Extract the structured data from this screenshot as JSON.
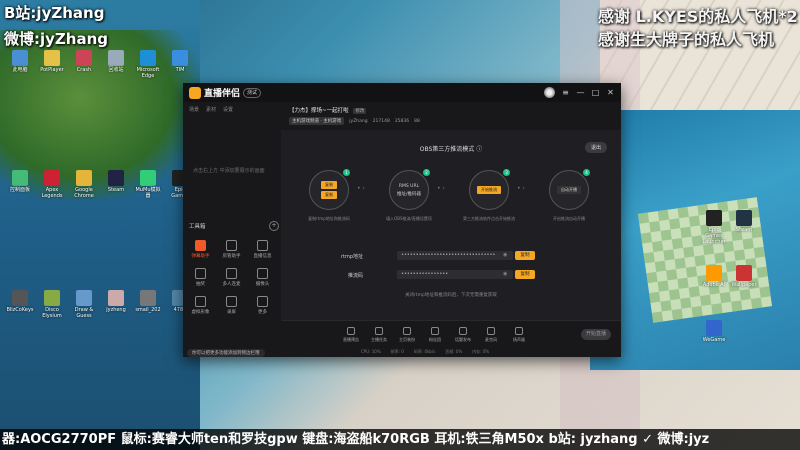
{
  "stream_overlay": {
    "top_left_1": "B站:jyZhang",
    "top_left_2": "微博:jyZhang",
    "top_right_1": "感谢 L.KYES的私人飞机*2",
    "top_right_2": "感谢生大牌子的私人飞机",
    "bottom_bar": "器:AOCG2770PF  鼠标:赛睿大师ten和罗技gpw  键盘:海盗船k70RGB 耳机:铁三角M50x b站: jyzhang  ✓ 微博:jyz"
  },
  "desktop_icons": [
    {
      "label": "此电脑",
      "color": "#4a8fd4"
    },
    {
      "label": "PotPlayer",
      "color": "#e6c14a"
    },
    {
      "label": "Crash",
      "color": "#c45"
    },
    {
      "label": "回收站",
      "color": "#9ab"
    },
    {
      "label": "Microsoft Edge",
      "color": "#1e8fd6"
    },
    {
      "label": "TIM",
      "color": "#3a8ee0"
    },
    {
      "label": "控制面板",
      "color": "#4b7"
    },
    {
      "label": "Apex Legends",
      "color": "#c23"
    },
    {
      "label": "Google Chrome",
      "color": "#e5b43a"
    },
    {
      "label": "Steam",
      "color": "#224"
    },
    {
      "label": "MuMu模拟器",
      "color": "#3c7"
    },
    {
      "label": "Epic Games",
      "color": "#222"
    },
    {
      "label": "BlizCoKeys",
      "color": "#555"
    },
    {
      "label": "Disco Elysium",
      "color": "#8a4"
    },
    {
      "label": "Draw & Guess",
      "color": "#69c"
    },
    {
      "label": "jyzheng",
      "color": "#caa"
    },
    {
      "label": "smail_202",
      "color": "#777"
    },
    {
      "label": "4788",
      "color": "#58a"
    }
  ],
  "right_icons": [
    {
      "label": "Epic Games Launcher",
      "color": "#222"
    },
    {
      "label": "Steam",
      "color": "#234"
    },
    {
      "label": "Adobe Ai",
      "color": "#f90"
    },
    {
      "label": "Wallpaper",
      "color": "#c33"
    },
    {
      "label": "WeGame",
      "color": "#36c"
    }
  ],
  "app": {
    "name": "直播伴侣",
    "version": "测试",
    "window_controls": [
      "—",
      "□",
      "✕"
    ]
  },
  "sidebar": {
    "tabs": [
      "场景",
      "素材",
      "设置"
    ],
    "empty_hint": "点击右上方 中添加要展示的画面",
    "tools_title": "工具箱",
    "tools": [
      {
        "label": "弹幕助手",
        "active": true
      },
      {
        "label": "房管助手",
        "active": false
      },
      {
        "label": "直播信息",
        "active": false
      },
      {
        "label": "抽奖",
        "active": false
      },
      {
        "label": "多人连麦",
        "active": false
      },
      {
        "label": "摄像头",
        "active": false
      },
      {
        "label": "虚拟形象",
        "active": false
      },
      {
        "label": "录屏",
        "active": false
      },
      {
        "label": "更多",
        "active": false
      }
    ],
    "tip": "你可以把更多功能添加到侧边栏哦"
  },
  "room": {
    "title": "【力杰】撑场~一起打啦",
    "edit_label": "修改",
    "category": "主机游戏频道 · 主机游戏",
    "user": "jyZhang",
    "fans": "217148",
    "likes": "25836",
    "room_level": "88"
  },
  "main": {
    "mode_title": "OBS第三方推流模式 ⓘ",
    "exit_label": "退出",
    "steps": [
      {
        "num": "1",
        "top": "复制",
        "bottom": "复制",
        "desc": "复制rtmp地址和推流码"
      },
      {
        "num": "2",
        "top": "RMS URL",
        "bottom": "推址/推码器",
        "desc": "填入OBS推流/直播设置项"
      },
      {
        "num": "3",
        "top": "开始推流",
        "bottom": "",
        "desc": "第三方推流软件点击开始推流"
      },
      {
        "num": "4",
        "top": "自动开播",
        "bottom": "",
        "desc": "开启推流自动开播"
      }
    ],
    "rtmp_label": "rtmp地址",
    "rtmp_value": "••••••••••••••••••••••••••••••••",
    "key_label": "推流码",
    "key_value": "••••••••••••••••",
    "copy_label": "复制",
    "form_tip": "关闭rtmp地址和推流码后，下次无需重复获取"
  },
  "bottom": {
    "tools": [
      "直播预告",
      "主播任务",
      "主页装扮",
      "粉丝团",
      "话题发布",
      "麦克风",
      "扬声器"
    ],
    "live_label": "开始直播",
    "status": [
      "CPU: 10%",
      "帧率: 0",
      "码率: 0kb/s",
      "丢帧: 0%",
      "内存: 0%"
    ]
  }
}
